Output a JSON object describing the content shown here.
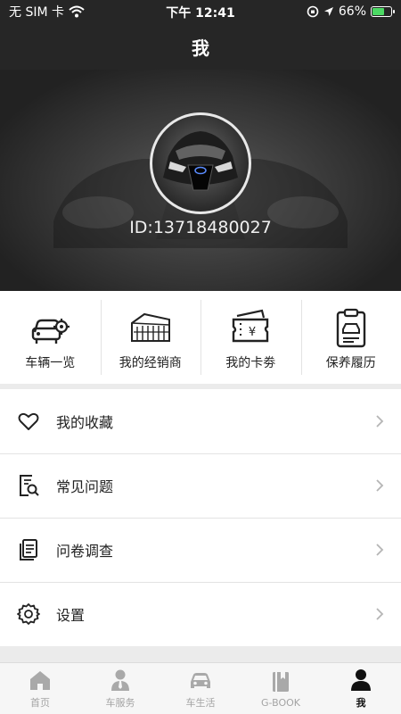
{
  "status_bar": {
    "carrier": "无 SIM 卡",
    "time": "下午 12:41",
    "battery": "66%",
    "battery_level": 0.66
  },
  "header": {
    "title": "我"
  },
  "profile": {
    "id_text": "ID:13718480027"
  },
  "quick_actions": [
    {
      "label": "车辆一览",
      "icon": "car-gear-icon"
    },
    {
      "label": "我的经销商",
      "icon": "dealer-building-icon"
    },
    {
      "label": "我的卡劵",
      "icon": "coupon-icon"
    },
    {
      "label": "保养履历",
      "icon": "maintenance-clipboard-icon"
    }
  ],
  "menu": [
    {
      "label": "我的收藏",
      "icon": "heart-icon"
    },
    {
      "label": "常见问题",
      "icon": "document-search-icon"
    },
    {
      "label": "问卷调查",
      "icon": "survey-icon"
    },
    {
      "label": "设置",
      "icon": "gear-icon"
    }
  ],
  "tabbar": {
    "items": [
      {
        "label": "首页",
        "icon": "home-icon"
      },
      {
        "label": "车服务",
        "icon": "service-person-icon"
      },
      {
        "label": "车生活",
        "icon": "car-icon"
      },
      {
        "label": "G-BOOK",
        "icon": "book-icon"
      },
      {
        "label": "我",
        "icon": "person-icon"
      }
    ],
    "active": "我"
  },
  "colors": {
    "header_bg": "#262626",
    "battery_green": "#4cd964",
    "inactive_tab": "#a4a4a4"
  }
}
